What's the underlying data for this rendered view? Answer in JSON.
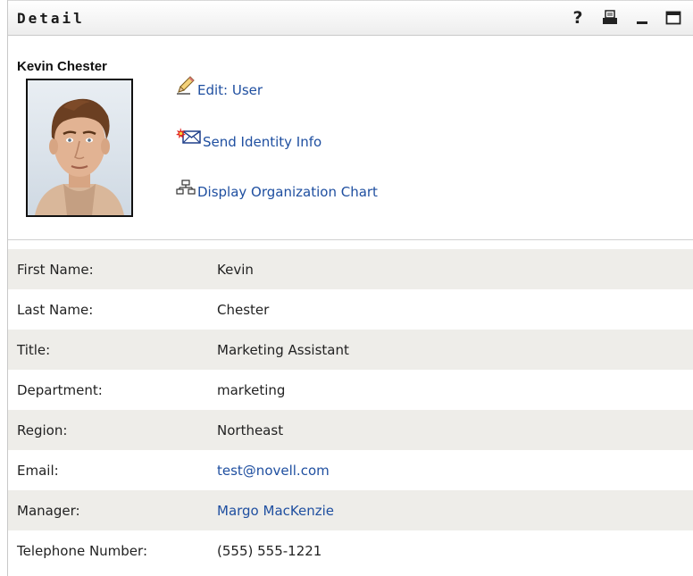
{
  "panel": {
    "title": "Detail",
    "controls": {
      "help": "?"
    }
  },
  "user": {
    "name": "Kevin Chester"
  },
  "actions": {
    "edit": "Edit: User",
    "send_identity": "Send Identity Info",
    "org_chart": "Display Organization Chart"
  },
  "fields": [
    {
      "label": "First Name:",
      "value": "Kevin"
    },
    {
      "label": "Last Name:",
      "value": "Chester"
    },
    {
      "label": "Title:",
      "value": "Marketing Assistant"
    },
    {
      "label": "Department:",
      "value": "marketing"
    },
    {
      "label": "Region:",
      "value": "Northeast"
    },
    {
      "label": "Email:",
      "value": "test@novell.com"
    },
    {
      "label": "Manager:",
      "value": "Margo MacKenzie"
    },
    {
      "label": "Telephone Number:",
      "value": "(555) 555-1221"
    }
  ],
  "colors": {
    "link": "#1f4fa0",
    "row_shade": "#eeede9"
  },
  "icons": {
    "help": "help-icon",
    "print": "print-icon",
    "minimize": "minimize-icon",
    "maximize": "maximize-icon",
    "edit": "pencil-icon",
    "send": "envelope-icon",
    "org": "org-chart-icon"
  }
}
